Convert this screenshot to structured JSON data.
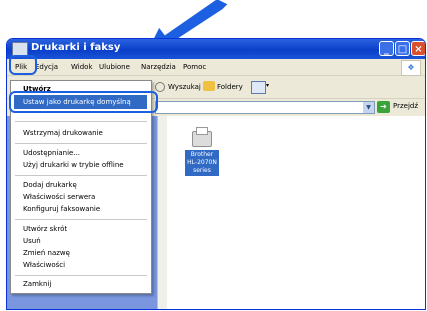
{
  "window": {
    "title": "Drukarki i faksy"
  },
  "menubar": {
    "items": [
      "Plik",
      "Edycja",
      "Widok",
      "Ulubione",
      "Narzędzia",
      "Pomoc"
    ]
  },
  "toolbar": {
    "search_label": "Wyszukaj",
    "folders_label": "Foldery"
  },
  "addressbar": {
    "go_label": "Przejdź"
  },
  "file_menu": {
    "first_item": "Utwórz",
    "highlighted_item": "Ustaw jako drukarkę domyślną",
    "group1": [
      "Wstrzymaj drukowanie"
    ],
    "group2": [
      "Udostępnianie...",
      "Użyj drukarki w trybie offline"
    ],
    "group3": [
      "Dodaj drukarkę",
      "Właściwości serwera",
      "Konfiguruj faksowanie"
    ],
    "group4": [
      "Utwórz skrót",
      "Usuń",
      "Zmień nazwę",
      "Właściwości"
    ],
    "group5": [
      "Zamknij"
    ]
  },
  "printer": {
    "label": "Brother HL-2070N series"
  },
  "colors": {
    "highlight": "#316ac5",
    "callout": "#1c5fe0",
    "titlebar": "#0a3fc8"
  }
}
